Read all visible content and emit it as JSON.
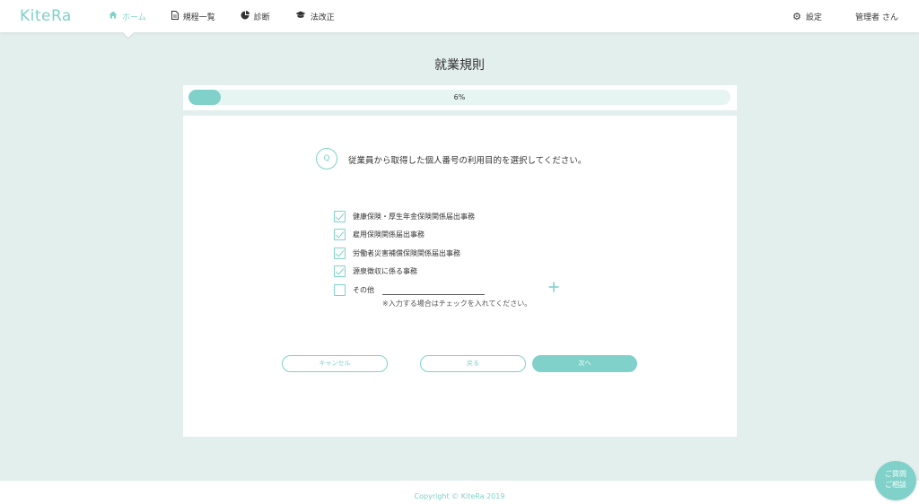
{
  "app": {
    "logo": "KiteRa"
  },
  "nav": {
    "items": [
      {
        "label": "ホーム",
        "icon": "home-icon",
        "active": true
      },
      {
        "label": "規程一覧",
        "icon": "document-icon",
        "active": false
      },
      {
        "label": "診断",
        "icon": "pie-chart-icon",
        "active": false
      },
      {
        "label": "法改正",
        "icon": "graduation-cap-icon",
        "active": false
      }
    ],
    "settings_label": "設定",
    "user_label": "管理者 さん"
  },
  "page": {
    "title": "就業規則"
  },
  "progress": {
    "value": 0.06,
    "label": "6%"
  },
  "question": {
    "badge": "Q",
    "text": "従業員から取得した個人番号の利用目的を選択してください。"
  },
  "options": [
    {
      "label": "健康保険・厚生年金保険関係届出事務",
      "checked": true
    },
    {
      "label": "雇用保険関係届出事務",
      "checked": true
    },
    {
      "label": "労働者災害補償保険関係届出事務",
      "checked": true
    },
    {
      "label": "源泉徴収に係る事務",
      "checked": true
    },
    {
      "label": "その他",
      "checked": false,
      "input_value": ""
    }
  ],
  "note": "※入力する場合はチェックを入れてください。",
  "buttons": {
    "cancel": "キャンセル",
    "back": "戻る",
    "next": "次へ"
  },
  "footer": {
    "copyright": "Copyright © KiteRa 2019"
  },
  "consult": {
    "line1": "ご質問",
    "line2": "ご相談"
  },
  "colors": {
    "accent": "#7fd1c9",
    "background": "#e3efed"
  }
}
